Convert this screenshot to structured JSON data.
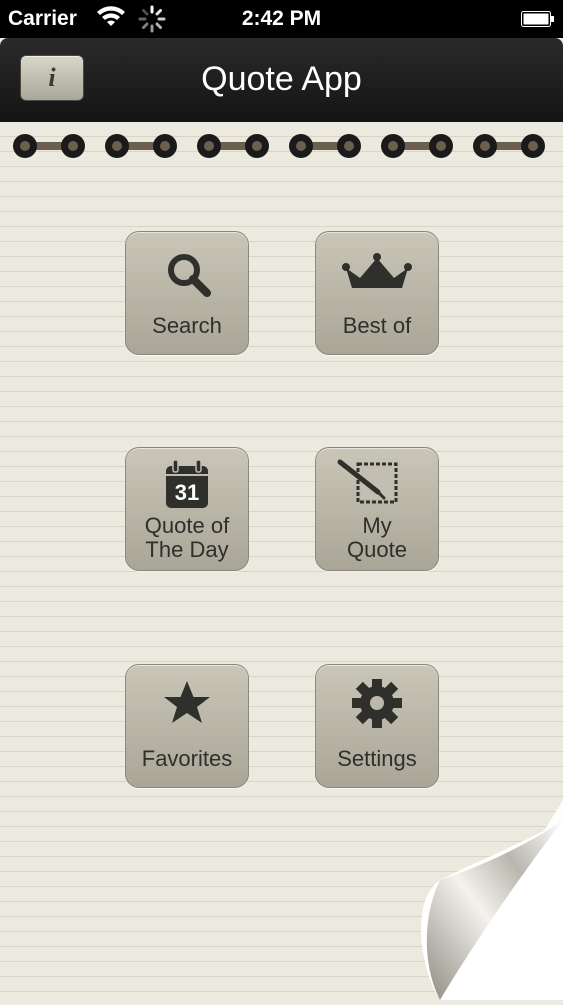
{
  "status_bar": {
    "carrier": "Carrier",
    "time": "2:42 PM"
  },
  "nav": {
    "title": "Quote App",
    "info_label": "i"
  },
  "menu": {
    "search": "Search",
    "best_of": "Best of",
    "qotd_line1": "Quote of",
    "qotd_line2": "The Day",
    "qotd_day": "31",
    "my_quote_line1": "My",
    "my_quote_line2": "Quote",
    "favorites": "Favorites",
    "settings": "Settings"
  },
  "icons": {
    "search": "magnifier-icon",
    "best_of": "crown-icon",
    "qotd": "calendar-icon",
    "my_quote": "pen-paper-icon",
    "favorites": "star-icon",
    "settings": "gear-icon"
  },
  "colors": {
    "paper": "#ece9de",
    "navbar": "#1c1c1c",
    "tile": "#b8b5a8",
    "icon": "#2f2f2b"
  }
}
